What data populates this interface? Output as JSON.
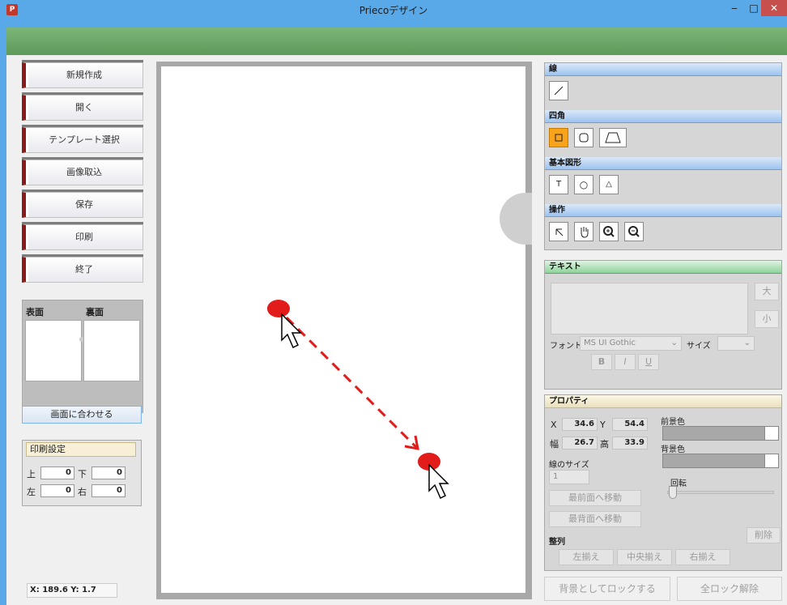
{
  "window": {
    "title": "Priecoデザイン",
    "minimize": "‒",
    "maximize": "□",
    "close": "✕"
  },
  "left_menu": {
    "buttons": [
      "新規作成",
      "開く",
      "テンプレート選択",
      "画像取込",
      "保存",
      "印刷",
      "終了"
    ]
  },
  "faces": {
    "front_label": "表面",
    "back_label": "裏面"
  },
  "fit_button": "画面に合わせる",
  "print_settings": {
    "title": "印刷設定",
    "top_label": "上",
    "top_value": "0",
    "bottom_label": "下",
    "bottom_value": "0",
    "left_label": "左",
    "left_value": "0",
    "right_label": "右",
    "right_value": "0"
  },
  "status": {
    "coords": "X: 189.6  Y: 1.7"
  },
  "tools": {
    "line_header": "線",
    "rect_header": "四角",
    "basic_header": "基本図形",
    "op_header": "操作",
    "line_icon": "line-tool",
    "rect_icons": [
      "rectangle-tool",
      "rounded-rect-tool",
      "trapezoid-tool"
    ],
    "basic_labels": [
      "T",
      "○",
      "△"
    ],
    "op_icons": [
      "pointer-tool",
      "hand-tool",
      "zoom-in-tool",
      "zoom-out-tool"
    ],
    "active_color": "#f9a31b"
  },
  "text_panel": {
    "header": "テキスト",
    "big_btn": "大",
    "small_btn": "小",
    "font_label": "フォント",
    "font_value": "MS UI Gothic",
    "size_label": "サイズ",
    "bold": "B",
    "italic": "I",
    "underline": "U"
  },
  "properties": {
    "header": "プロパティ",
    "x_label": "X",
    "x_value": "34.6",
    "y_label": "Y",
    "y_value": "54.4",
    "w_label": "幅",
    "w_value": "26.7",
    "h_label": "高",
    "h_value": "33.9",
    "fg_label": "前景色",
    "bg_label": "背景色",
    "line_size_label": "線のサイズ",
    "line_size_value": "1",
    "rotate_label": "回転",
    "front_btn": "最前面へ移動",
    "back_btn": "最背面へ移動",
    "delete_btn": "削除",
    "align_label": "整列",
    "align_left": "左揃え",
    "align_center": "中央揃え",
    "align_right": "右揃え"
  },
  "bottom_buttons": {
    "lock": "背景としてロックする",
    "unlock": "全ロック解除"
  },
  "annotation": {
    "color": "#e21b1b"
  }
}
